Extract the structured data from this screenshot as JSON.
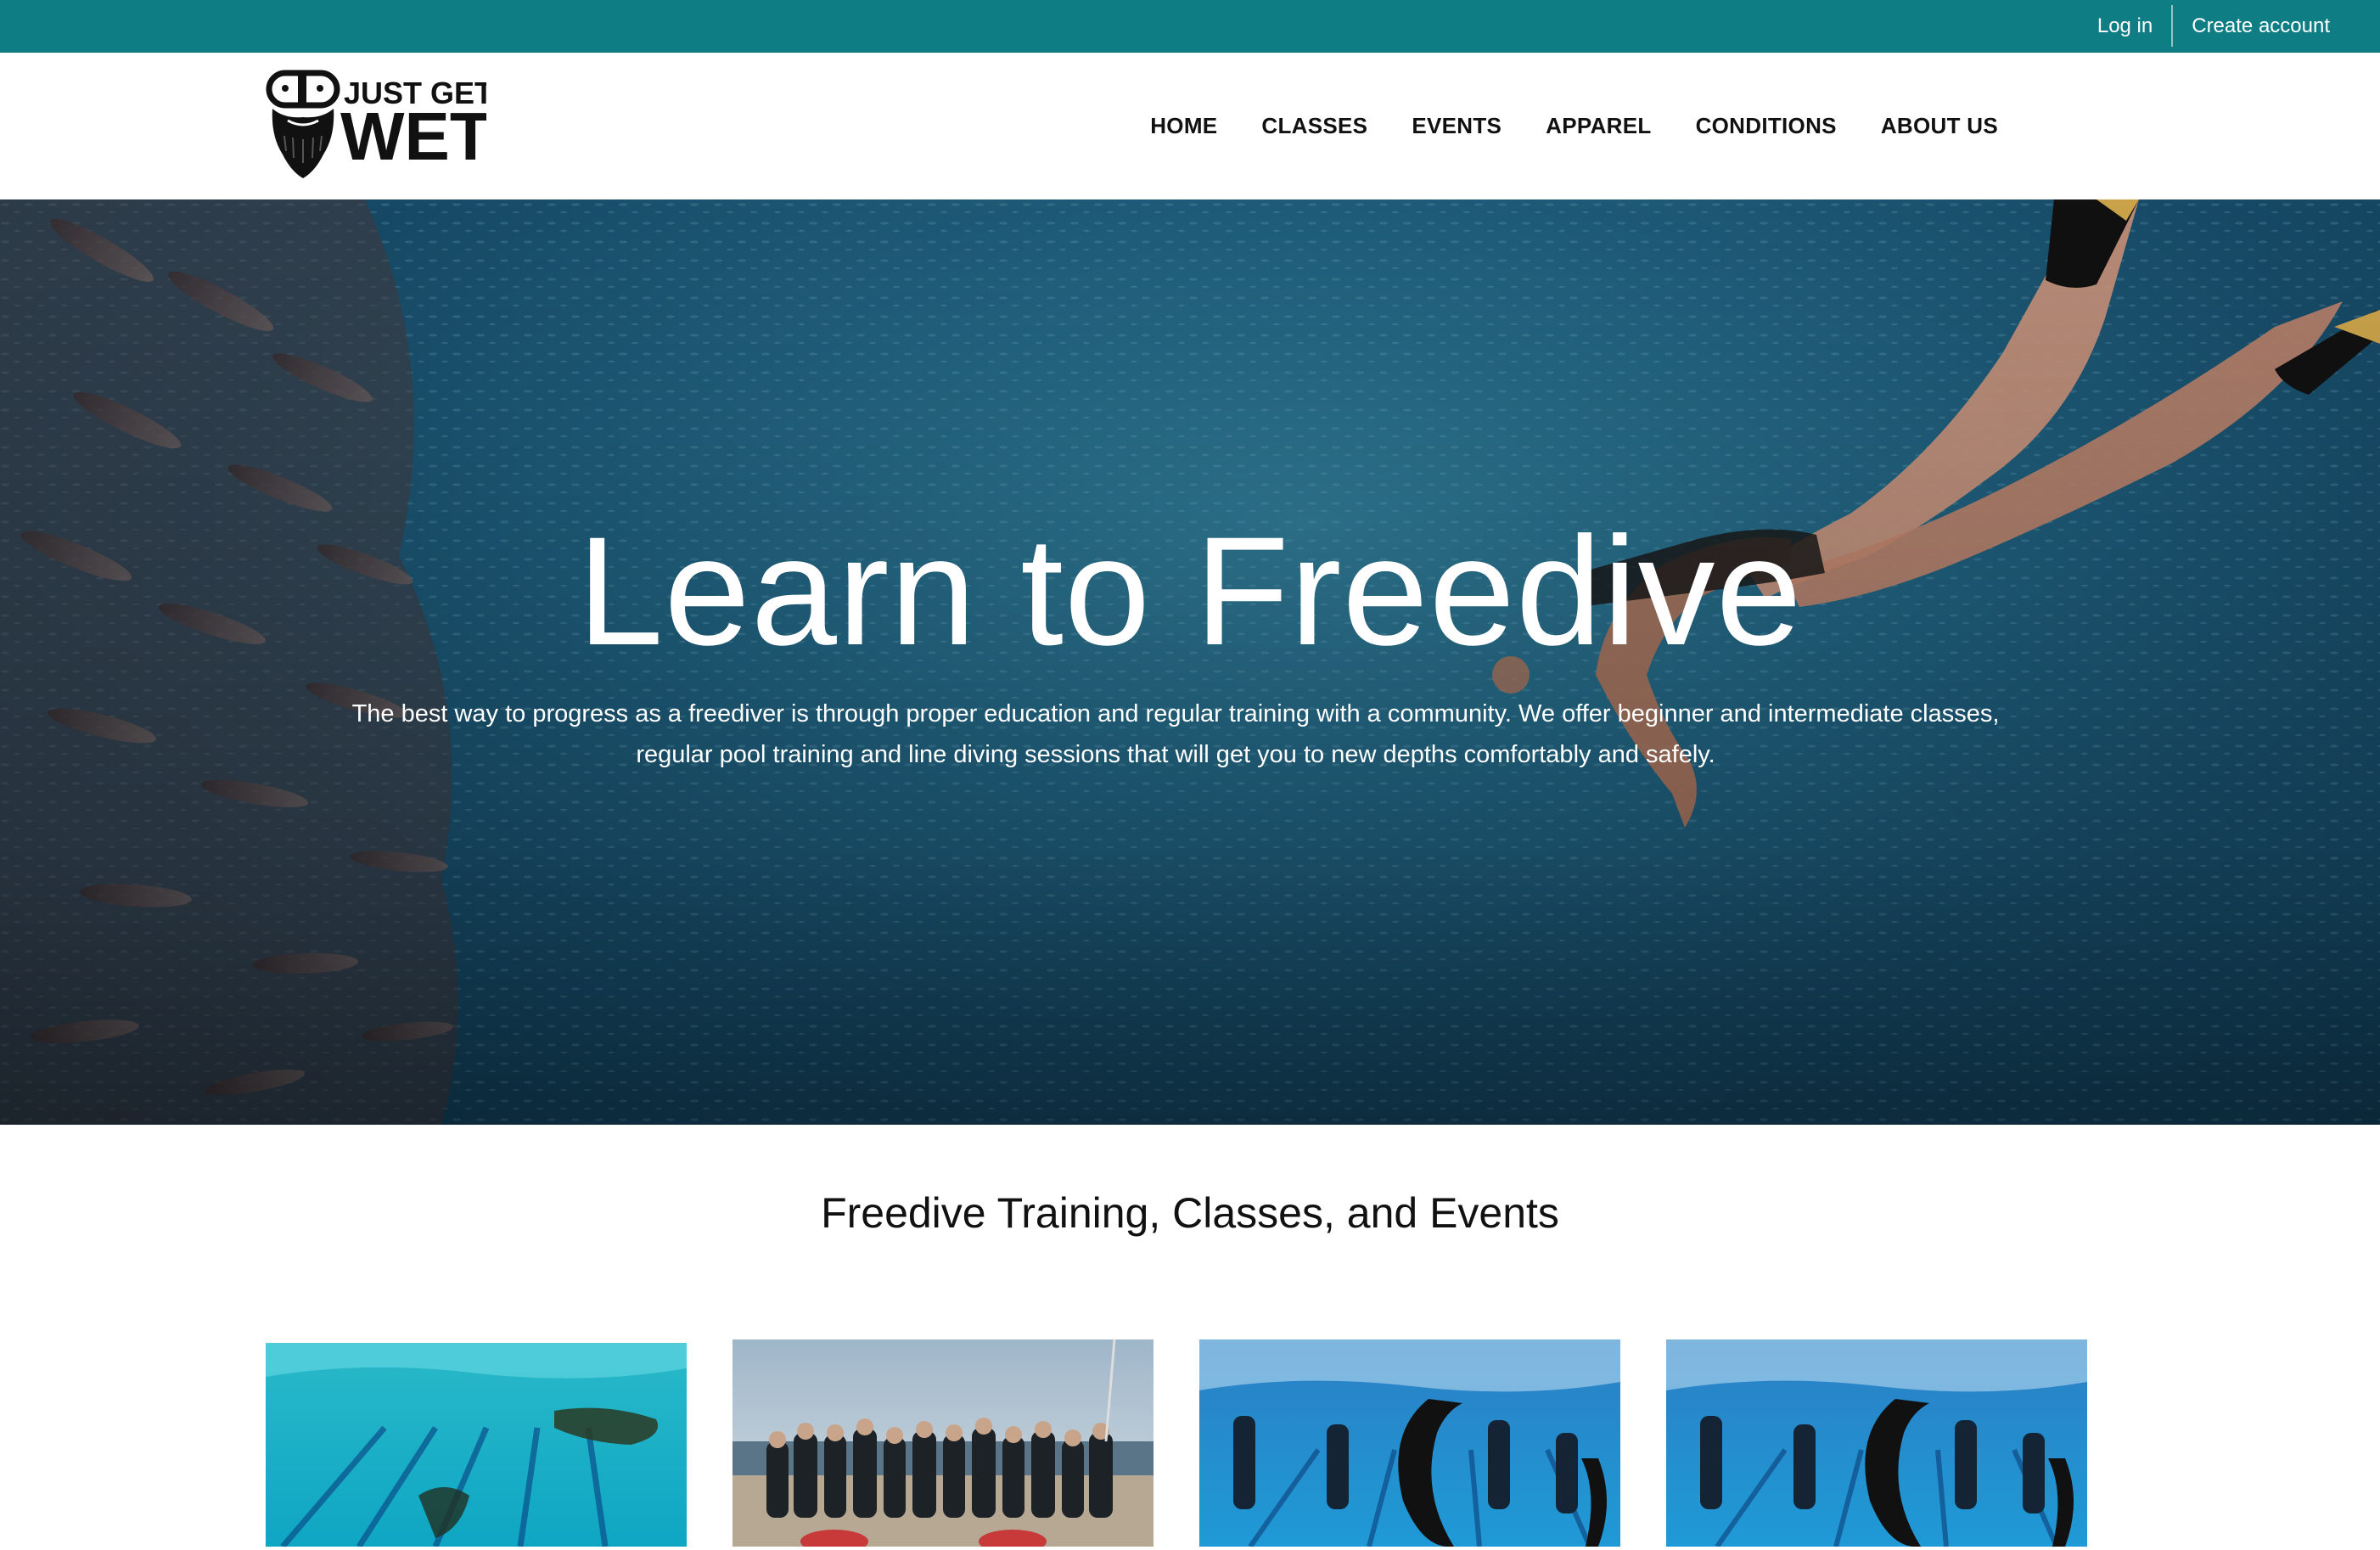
{
  "topbar": {
    "login_label": "Log in",
    "create_account_label": "Create account",
    "bg_color": "#0f7e84"
  },
  "header": {
    "logo": {
      "line1": "JUST GET",
      "line2": "WET"
    },
    "nav": [
      "HOME",
      "CLASSES",
      "EVENTS",
      "APPAREL",
      "CONDITIONS",
      "ABOUT US"
    ]
  },
  "hero": {
    "title": "Learn to Freedive",
    "subtitle": "The best way to progress as a freediver is through proper education and regular training with a community. We offer beginner and intermediate classes, regular pool training and line diving sessions that will get you to new depths comfortably and safely."
  },
  "section": {
    "title": "Freedive Training, Classes, and Events"
  },
  "cards": [
    {
      "image": "pool-freediver-photo"
    },
    {
      "image": "beach-group-photo"
    },
    {
      "image": "monofin-pool-photo"
    },
    {
      "image": "monofin-pool-photo"
    }
  ]
}
